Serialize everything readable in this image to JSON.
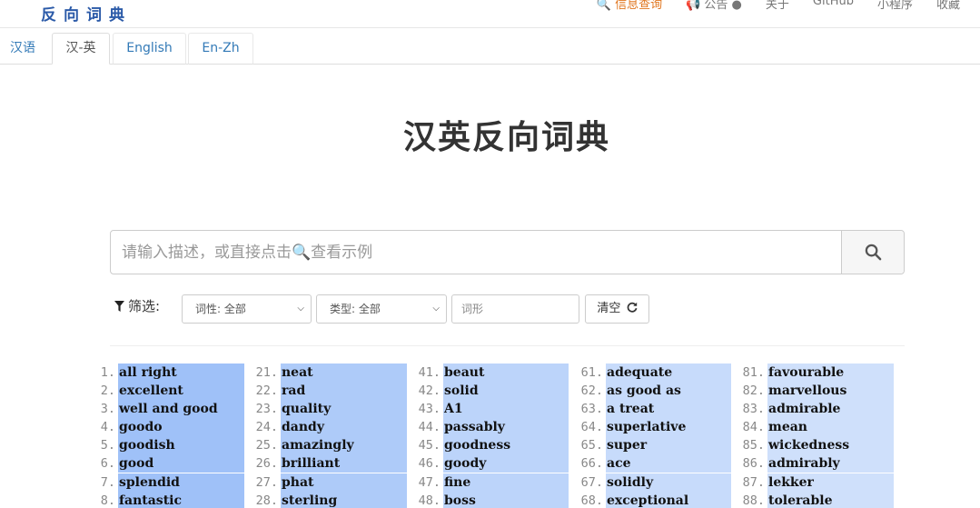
{
  "app": {
    "logo": "反向词典"
  },
  "topnav": {
    "items": [
      "🔍 信息查询",
      "📢 公告 ●",
      "关于",
      "GitHub",
      "小程序",
      "收藏"
    ]
  },
  "tabs": [
    "汉语",
    "汉-英",
    "English",
    "En-Zh"
  ],
  "active_tab": "汉-英",
  "title": "汉英反向词典",
  "search": {
    "placeholder": "请输入描述，或直接点击🔍查看示例",
    "value": ""
  },
  "filters": {
    "label": "筛选:",
    "pos_select": "词性: 全部",
    "type_select": "类型: 全部",
    "form_placeholder": "词形",
    "clear_label": "清空"
  },
  "results": {
    "colors": [
      "#9fc1f8",
      "#aecbf9",
      "#bcd4fa",
      "#c7dbfb",
      "#cfe0fb"
    ],
    "columns": [
      [
        {
          "n": "1.",
          "w": "all right"
        },
        {
          "n": "2.",
          "w": "excellent"
        },
        {
          "n": "3.",
          "w": "well and good"
        },
        {
          "n": "4.",
          "w": "goodo"
        },
        {
          "n": "5.",
          "w": "goodish"
        },
        {
          "n": "6.",
          "w": "good"
        },
        {
          "n": "7.",
          "w": "splendid"
        },
        {
          "n": "8.",
          "w": "fantastic"
        }
      ],
      [
        {
          "n": "21.",
          "w": "neat"
        },
        {
          "n": "22.",
          "w": "rad"
        },
        {
          "n": "23.",
          "w": "quality"
        },
        {
          "n": "24.",
          "w": "dandy"
        },
        {
          "n": "25.",
          "w": "amazingly"
        },
        {
          "n": "26.",
          "w": "brilliant"
        },
        {
          "n": "27.",
          "w": "phat"
        },
        {
          "n": "28.",
          "w": "sterling"
        }
      ],
      [
        {
          "n": "41.",
          "w": "beaut"
        },
        {
          "n": "42.",
          "w": "solid"
        },
        {
          "n": "43.",
          "w": "A1"
        },
        {
          "n": "44.",
          "w": "passably"
        },
        {
          "n": "45.",
          "w": "goodness"
        },
        {
          "n": "46.",
          "w": "goody"
        },
        {
          "n": "47.",
          "w": "fine"
        },
        {
          "n": "48.",
          "w": "boss"
        }
      ],
      [
        {
          "n": "61.",
          "w": "adequate"
        },
        {
          "n": "62.",
          "w": "as good as"
        },
        {
          "n": "63.",
          "w": "a treat"
        },
        {
          "n": "64.",
          "w": "superlative"
        },
        {
          "n": "65.",
          "w": "super"
        },
        {
          "n": "66.",
          "w": "ace"
        },
        {
          "n": "67.",
          "w": "solidly"
        },
        {
          "n": "68.",
          "w": "exceptional"
        }
      ],
      [
        {
          "n": "81.",
          "w": "favourable"
        },
        {
          "n": "82.",
          "w": "marvellous"
        },
        {
          "n": "83.",
          "w": "admirable"
        },
        {
          "n": "84.",
          "w": "mean"
        },
        {
          "n": "85.",
          "w": "wickedness"
        },
        {
          "n": "86.",
          "w": "admirably"
        },
        {
          "n": "87.",
          "w": "lekker"
        },
        {
          "n": "88.",
          "w": "tolerable"
        }
      ]
    ]
  }
}
